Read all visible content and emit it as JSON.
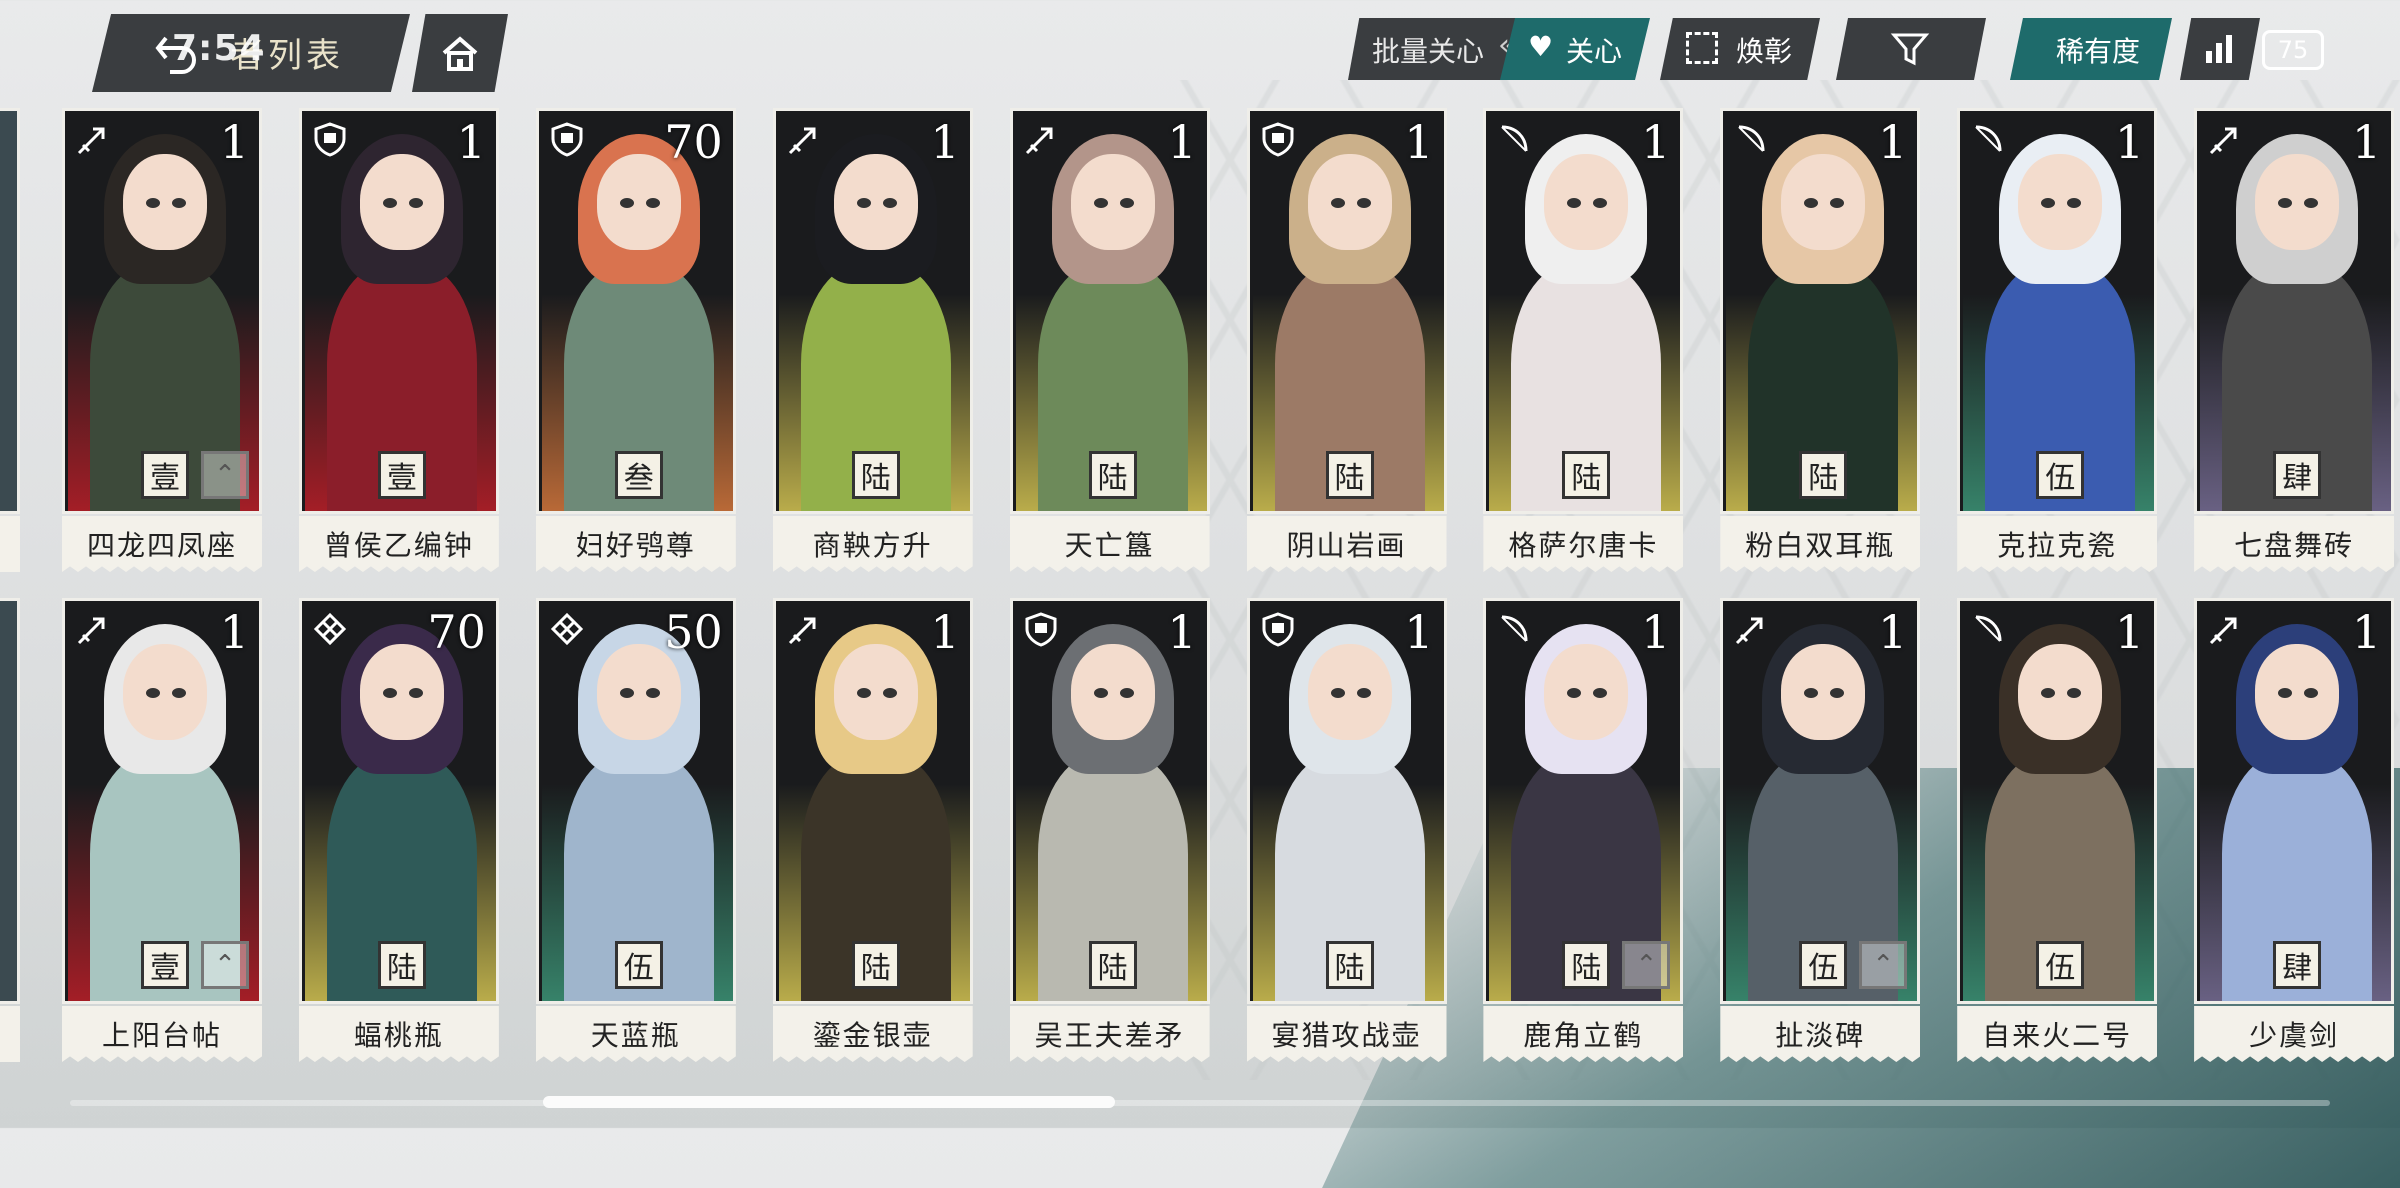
{
  "header": {
    "title": "者列表",
    "status_overlay": "7:54",
    "batch_label": "批量关心",
    "care_label": "关心",
    "filter_label": "焕彰",
    "rarity_label": "稀有度",
    "battery": "75"
  },
  "colors": {
    "teal": "#1e6b6b",
    "dark": "#3a3d40",
    "red_glow": "#c0212b",
    "gold_glow": "#d3c25a"
  },
  "rows": [
    {
      "cards": [
        {
          "name": "四龙四凤座",
          "level": "1",
          "rank": "壹",
          "class_icon": "pen-icon",
          "glow": "red",
          "mark": true
        },
        {
          "name": "曾侯乙编钟",
          "level": "1",
          "rank": "壹",
          "class_icon": "shield-icon",
          "glow": "red",
          "mark": false
        },
        {
          "name": "妇好鸮尊",
          "level": "70",
          "rank": "叁",
          "class_icon": "shield-icon",
          "glow": "orange",
          "mark": false
        },
        {
          "name": "商鞅方升",
          "level": "1",
          "rank": "陆",
          "class_icon": "pen-icon",
          "glow": "gold",
          "mark": false
        },
        {
          "name": "天亡簋",
          "level": "1",
          "rank": "陆",
          "class_icon": "pen-icon",
          "glow": "gold",
          "mark": false
        },
        {
          "name": "阴山岩画",
          "level": "1",
          "rank": "陆",
          "class_icon": "shield-icon",
          "glow": "gold",
          "mark": false
        },
        {
          "name": "格萨尔唐卡",
          "level": "1",
          "rank": "陆",
          "class_icon": "bow-icon",
          "glow": "gold",
          "mark": false
        },
        {
          "name": "粉白双耳瓶",
          "level": "1",
          "rank": "陆",
          "class_icon": "bow-icon",
          "glow": "gold",
          "mark": false
        },
        {
          "name": "克拉克瓷",
          "level": "1",
          "rank": "伍",
          "class_icon": "bow-icon",
          "glow": "teal",
          "mark": false
        },
        {
          "name": "七盘舞砖",
          "level": "1",
          "rank": "肆",
          "class_icon": "pen-icon",
          "glow": "purple",
          "mark": false
        }
      ]
    },
    {
      "cards": [
        {
          "name": "上阳台帖",
          "level": "1",
          "rank": "壹",
          "class_icon": "pen-icon",
          "glow": "red",
          "mark": true
        },
        {
          "name": "蝠桃瓶",
          "level": "70",
          "rank": "陆",
          "class_icon": "knot-icon",
          "glow": "gold",
          "mark": false
        },
        {
          "name": "天蓝瓶",
          "level": "50",
          "rank": "伍",
          "class_icon": "knot-icon",
          "glow": "teal",
          "mark": false
        },
        {
          "name": "鎏金银壶",
          "level": "1",
          "rank": "陆",
          "class_icon": "pen-icon",
          "glow": "gold",
          "mark": false
        },
        {
          "name": "吴王夫差矛",
          "level": "1",
          "rank": "陆",
          "class_icon": "shield-icon",
          "glow": "gold",
          "mark": false
        },
        {
          "name": "宴猎攻战壶",
          "level": "1",
          "rank": "陆",
          "class_icon": "shield-icon",
          "glow": "gold",
          "mark": false
        },
        {
          "name": "鹿角立鹤",
          "level": "1",
          "rank": "陆",
          "class_icon": "bow-icon",
          "glow": "gold",
          "mark": true
        },
        {
          "name": "扯淡碑",
          "level": "1",
          "rank": "伍",
          "class_icon": "pen-icon",
          "glow": "teal",
          "mark": true
        },
        {
          "name": "自来火二号",
          "level": "1",
          "rank": "伍",
          "class_icon": "bow-icon",
          "glow": "teal",
          "mark": false
        },
        {
          "name": "少虞剑",
          "level": "1",
          "rank": "肆",
          "class_icon": "pen-icon",
          "glow": "purple",
          "mark": false
        }
      ]
    }
  ],
  "scroll": {
    "position_fraction": 0.28
  }
}
